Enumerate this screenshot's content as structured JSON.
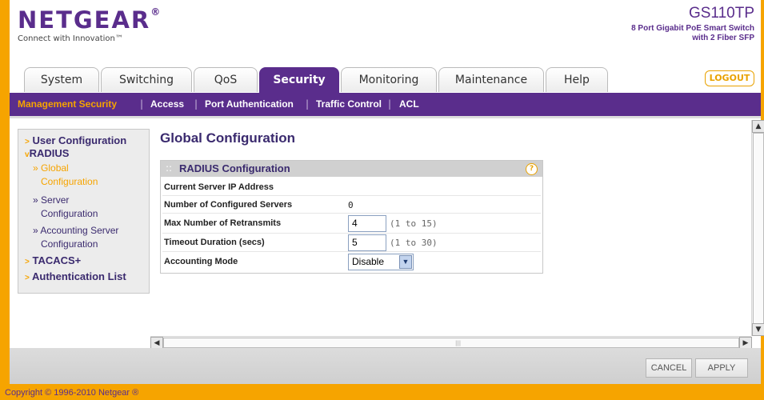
{
  "header": {
    "logo": "NETGEAR",
    "logo_mark": "®",
    "tagline": "Connect with Innovation™",
    "model": "GS110TP",
    "model_desc_line1": "8 Port Gigabit PoE Smart Switch",
    "model_desc_line2": "with 2 Fiber SFP",
    "logout": "LOGOUT"
  },
  "tabs": [
    {
      "label": "System",
      "active": false
    },
    {
      "label": "Switching",
      "active": false
    },
    {
      "label": "QoS",
      "active": false
    },
    {
      "label": "Security",
      "active": true
    },
    {
      "label": "Monitoring",
      "active": false
    },
    {
      "label": "Maintenance",
      "active": false
    },
    {
      "label": "Help",
      "active": false
    }
  ],
  "subnav": [
    {
      "label": "Management Security",
      "active": true
    },
    {
      "label": "Access",
      "active": false
    },
    {
      "label": "Port Authentication",
      "active": false
    },
    {
      "label": "Traffic Control",
      "active": false
    },
    {
      "label": "ACL",
      "active": false
    }
  ],
  "leftnav": {
    "user_configuration": "User Configuration",
    "radius": "RADIUS",
    "global_line1": "Global",
    "global_line2": "Configuration",
    "server_line1": "Server",
    "server_line2": "Configuration",
    "accounting_line1": "Accounting Server",
    "accounting_line2": "Configuration",
    "tacacs": "TACACS+",
    "auth_list": "Authentication List"
  },
  "page_title": "Global Configuration",
  "panel": {
    "title": "RADIUS Configuration",
    "help": "?",
    "rows": {
      "current_server_ip": {
        "label": "Current Server IP Address",
        "value": ""
      },
      "num_servers": {
        "label": "Number of Configured Servers",
        "value": "0"
      },
      "max_retransmits": {
        "label": "Max Number of Retransmits",
        "value": "4",
        "range": "(1 to 15)"
      },
      "timeout": {
        "label": "Timeout Duration (secs)",
        "value": "5",
        "range": "(1 to 30)"
      },
      "accounting_mode": {
        "label": "Accounting Mode",
        "value": "Disable"
      }
    }
  },
  "footer": {
    "cancel": "CANCEL",
    "apply": "APPLY"
  },
  "copyright": "Copyright © 1996-2010 Netgear ®",
  "icons": {
    "help": "help-circle-icon",
    "select_arrow": "chevron-down-icon",
    "scroll_up": "triangle-up-icon",
    "scroll_down": "triangle-down-icon",
    "scroll_left": "triangle-left-icon",
    "scroll_right": "triangle-right-icon"
  },
  "colors": {
    "brand_purple": "#5a2d8c",
    "accent_orange": "#f6a400"
  }
}
